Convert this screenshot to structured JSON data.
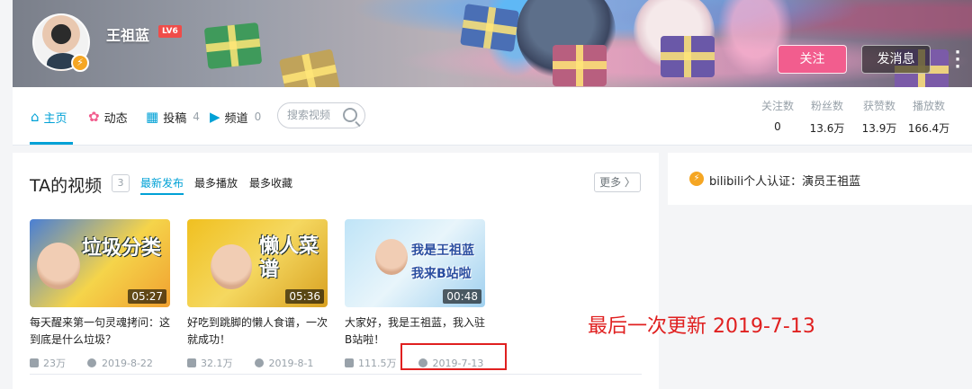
{
  "profile": {
    "name": "王祖蓝",
    "level": "LV6",
    "follow_label": "关注",
    "message_label": "发消息"
  },
  "nav": {
    "tabs": [
      {
        "label": "主页",
        "count": ""
      },
      {
        "label": "动态",
        "count": ""
      },
      {
        "label": "投稿",
        "count": "4"
      },
      {
        "label": "频道",
        "count": "0"
      }
    ],
    "search_placeholder": "搜索视频"
  },
  "stats": [
    {
      "label": "关注数",
      "value": "0"
    },
    {
      "label": "粉丝数",
      "value": "13.6万"
    },
    {
      "label": "获赞数",
      "value": "13.9万"
    },
    {
      "label": "播放数",
      "value": "166.4万"
    }
  ],
  "videos_section": {
    "title": "TA的视频",
    "count": "3",
    "sort_tabs": [
      "最新发布",
      "最多播放",
      "最多收藏"
    ],
    "more_label": "更多 〉",
    "videos": [
      {
        "title": "每天醒来第一句灵魂拷问：这到底是什么垃圾？",
        "duration": "05:27",
        "views": "23万",
        "date": "2019-8-22",
        "thumb_text": "垃圾分类"
      },
      {
        "title": "好吃到跳脚的懒人食谱，一次就成功！",
        "duration": "05:36",
        "views": "32.1万",
        "date": "2019-8-1",
        "thumb_text": "懒人菜谱"
      },
      {
        "title": "大家好，我是王祖蓝，我入驻B站啦！",
        "duration": "00:48",
        "views": "111.5万",
        "date": "2019-7-13",
        "thumb_text": "我是王祖蓝 我来B站啦"
      }
    ]
  },
  "annotation": "最后一次更新 2019-7-13",
  "certification": {
    "text": "bilibili个人认证：演员王祖蓝"
  }
}
